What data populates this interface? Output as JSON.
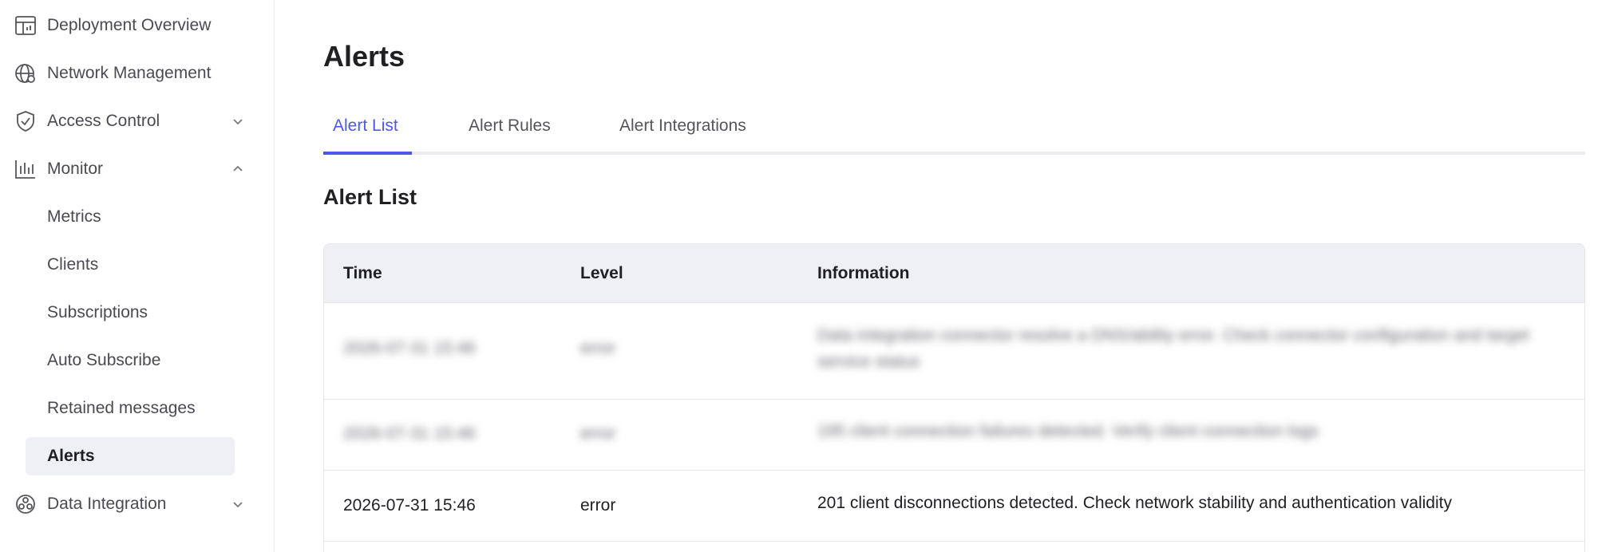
{
  "sidebar": {
    "items": [
      {
        "label": "Deployment Overview",
        "icon": "dashboard-icon"
      },
      {
        "label": "Network Management",
        "icon": "globe-gear-icon"
      },
      {
        "label": "Access Control",
        "icon": "shield-check-icon",
        "expandable": true
      },
      {
        "label": "Monitor",
        "icon": "bar-chart-icon",
        "expandable": true,
        "expanded": true
      },
      {
        "label": "Data Integration",
        "icon": "integration-icon",
        "expandable": true
      }
    ],
    "monitor_children": [
      {
        "label": "Metrics"
      },
      {
        "label": "Clients"
      },
      {
        "label": "Subscriptions"
      },
      {
        "label": "Auto Subscribe"
      },
      {
        "label": "Retained messages"
      },
      {
        "label": "Alerts",
        "active": true
      }
    ]
  },
  "page": {
    "title": "Alerts"
  },
  "tabs": [
    {
      "label": "Alert List",
      "active": true
    },
    {
      "label": "Alert Rules"
    },
    {
      "label": "Alert Integrations"
    }
  ],
  "section": {
    "title": "Alert List"
  },
  "table": {
    "columns": [
      "Time",
      "Level",
      "Information"
    ],
    "rows": [
      {
        "time": "2026-07-31 15:46",
        "level": "error",
        "info": "Data integration connector resolve a DNS/ability error. Check connector configuration and target service status",
        "blurred": true
      },
      {
        "time": "2026-07-31 15:46",
        "level": "error",
        "info": "195 client connection failures detected. Verify client connection logs",
        "blurred": true
      },
      {
        "time": "2026-07-31 15:46",
        "level": "error",
        "info": "201 client disconnections detected. Check network stability and authentication validity",
        "blurred": false
      }
    ]
  },
  "colors": {
    "accent": "#4f56e8",
    "header_bg": "#eff0f4",
    "active_nav_bg": "#eef0f4"
  }
}
